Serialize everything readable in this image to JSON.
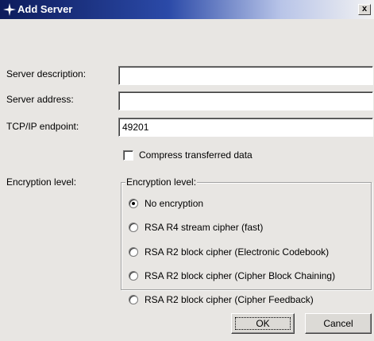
{
  "window": {
    "title": "Add Server",
    "close_label": "x"
  },
  "form": {
    "description_label": "Server description:",
    "description_value": "",
    "address_label": "Server address:",
    "address_value": "",
    "endpoint_label": "TCP/IP endpoint:",
    "endpoint_value": "49201",
    "compress_label": "Compress transferred data",
    "compress_checked": false,
    "encryption_label": "Encryption level:"
  },
  "encryption_group": {
    "legend": "Encryption level:",
    "options": [
      {
        "label": "No encryption",
        "checked": true
      },
      {
        "label": "RSA R4 stream cipher (fast)",
        "checked": false
      },
      {
        "label": "RSA R2 block cipher (Electronic Codebook)",
        "checked": false
      },
      {
        "label": "RSA R2 block cipher (Cipher Block Chaining)",
        "checked": false
      },
      {
        "label": "RSA R2 block cipher (Cipher Feedback)",
        "checked": false
      }
    ]
  },
  "buttons": {
    "ok": "OK",
    "cancel": "Cancel"
  }
}
